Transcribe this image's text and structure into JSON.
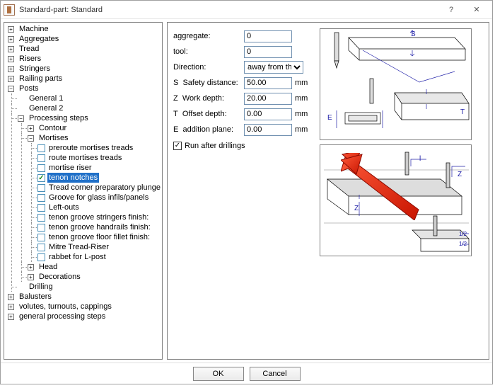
{
  "window": {
    "title": "Standard-part: Standard",
    "help_symbol": "?",
    "close_symbol": "✕"
  },
  "tree": {
    "machine": "Machine",
    "aggregates": "Aggregates",
    "tread": "Tread",
    "risers": "Risers",
    "stringers": "Stringers",
    "railing_parts": "Railing parts",
    "posts": "Posts",
    "general1": "General  1",
    "general2": "General  2",
    "processing_steps": "Processing steps",
    "contour": "Contour",
    "mortises": "Mortises",
    "preroute": "preroute mortises treads",
    "route": "route mortises treads",
    "mortise_riser": "mortise riser",
    "tenon_notches": "tenon notches",
    "tread_corner": "Tread corner preparatory plunge cut",
    "groove_glass": "Groove for glass infils/panels",
    "left_outs": "Left-outs",
    "tg_stringers": "tenon groove stringers finish:",
    "tg_handrails": "tenon groove handrails finish:",
    "tg_floor": "tenon groove floor fillet finish:",
    "mitre": "Mitre Tread-Riser",
    "rabbet": "rabbet for L-post",
    "head": "Head",
    "decorations": "Decorations",
    "drilling": "Drilling",
    "balusters": "Balusters",
    "volutes": "volutes, turnouts, cappings",
    "gps": "general processing steps"
  },
  "form": {
    "aggregate_label": "aggregate:",
    "aggregate_value": "0",
    "tool_label": "tool:",
    "tool_value": "0",
    "direction_label": "Direction:",
    "direction_value": "away from the w",
    "safety_prefix": "S",
    "safety_label": "Safety distance:",
    "safety_value": "50.00",
    "workdepth_prefix": "Z",
    "workdepth_label": "Work depth:",
    "workdepth_value": "20.00",
    "offset_prefix": "T",
    "offset_label": "Offset depth:",
    "offset_value": "0.00",
    "addition_prefix": "E",
    "addition_label": "addition plane:",
    "addition_value": "0.00",
    "unit_mm": "mm",
    "run_after_label": "Run after drillings"
  },
  "diagram_labels": {
    "S": "S",
    "E": "E",
    "T": "T",
    "Z": "Z",
    "l": "l",
    "h1": "1/2",
    "h2": "1/2"
  },
  "buttons": {
    "ok": "OK",
    "cancel": "Cancel"
  }
}
